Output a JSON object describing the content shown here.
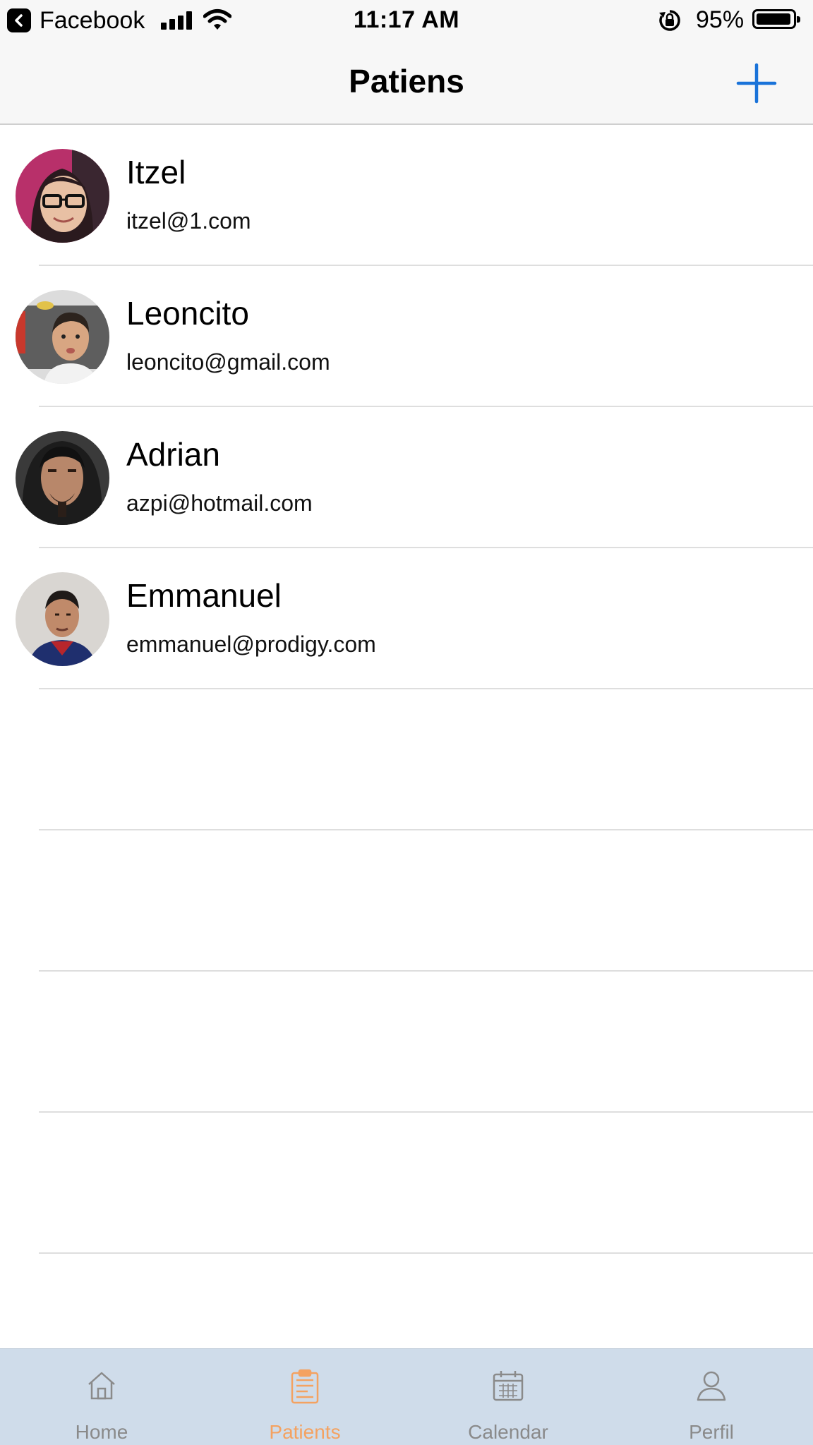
{
  "status_bar": {
    "back_app": "Facebook",
    "time": "11:17 AM",
    "battery_percent": "95%",
    "battery_level": 0.95
  },
  "nav": {
    "title": "Patiens",
    "add_icon": "plus-icon",
    "accent_color": "#1a73d9"
  },
  "patients": [
    {
      "name": "Itzel",
      "email": "itzel@1.com"
    },
    {
      "name": "Leoncito",
      "email": "leoncito@gmail.com"
    },
    {
      "name": "Adrian",
      "email": "azpi@hotmail.com"
    },
    {
      "name": "Emmanuel",
      "email": "emmanuel@prodigy.com"
    }
  ],
  "tabs": [
    {
      "label": "Home",
      "icon": "house-icon",
      "active": false
    },
    {
      "label": "Patients",
      "icon": "clipboard-icon",
      "active": true
    },
    {
      "label": "Calendar",
      "icon": "calendar-icon",
      "active": false
    },
    {
      "label": "Perfil",
      "icon": "person-icon",
      "active": false
    }
  ],
  "colors": {
    "active_tab": "#f4a261",
    "inactive_tab": "#8a8a8a",
    "tab_bar_bg": "#cfdcea"
  }
}
